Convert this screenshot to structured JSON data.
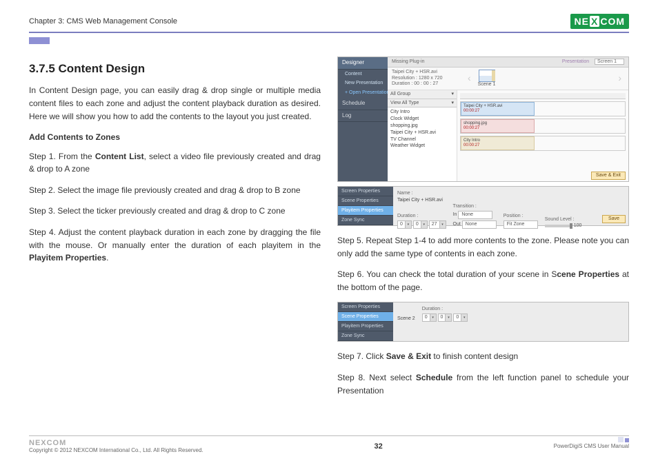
{
  "header": {
    "chapter": "Chapter 3: CMS Web Management Console",
    "brand_pre": "NE",
    "brand_mid": "X",
    "brand_post": "COM"
  },
  "left": {
    "heading": "3.7.5 Content Design",
    "intro": "In Content Design page, you can easily drag & drop single or multiple media content files to each zone and adjust the content playback duration as desired. Here we will show you how to add the contents to the layout you just created.",
    "sub": "Add Contents to Zones",
    "step1_a": "Step 1. From the ",
    "step1_b": "Content List",
    "step1_c": ", select a video file previously created and drag & drop to A zone",
    "step2": "Step 2. Select the image file previously created and drag & drop to B zone",
    "step3": "Step 3. Select the ticker previously created and drag & drop to C zone",
    "step4_a": "Step 4. Adjust the content playback duration in each zone by dragging the file with the mouse. Or manually enter the duration of each playitem in the ",
    "step4_b": "Playitem Properties",
    "step4_c": "."
  },
  "right": {
    "step5": "Step 5. Repeat Step 1-4 to add more contents to the zone. Please note you can only add the same type of contents in each zone.",
    "step6_a": "Step 6. You can check the total duration of your scene in S",
    "step6_b": "cene Properties",
    "step6_c": " at the bottom of the page.",
    "step7_a": "Step 7. Click ",
    "step7_b": "Save & Exit",
    "step7_c": " to finish content design",
    "step8_a": "Step 8. Next select ",
    "step8_b": "Schedule",
    "step8_c": " from the left function panel to schedule your Presentation"
  },
  "shot1": {
    "side": {
      "designer": "Designer",
      "content": "Content",
      "new_pres": "New Presentation",
      "open_pres": "+ Open Presentation",
      "schedule": "Schedule",
      "log": "Log"
    },
    "toolbar": {
      "missing": "Missing Plug-in",
      "presentation": "Presentation",
      "screen": "Screen 1"
    },
    "preview": {
      "file": "Taipei City + HSR.avi",
      "res": "Resolution : 1280 x 720",
      "dur": "Duration : 00 : 00 : 27",
      "scene": "Scene 1"
    },
    "list": {
      "group": "All Group",
      "type": "View All Type",
      "items": [
        "City Intro",
        "Clock Widget",
        "shopping.jpg",
        "Taipei City + HSR.avi",
        "TV Channel",
        "Weather Widget"
      ]
    },
    "tracks": {
      "t1_name": "Taipei City + HSR.avi",
      "t1_ts": "00:00:27",
      "t2_name": "shopping.jpg",
      "t2_ts": "00:00:27",
      "t3_name": "City Intro",
      "t3_ts": "00:00:27"
    },
    "save_exit": "Save & Exit"
  },
  "shot2": {
    "tabs": [
      "Screen Properties",
      "Scene Properties",
      "Playitem Properties",
      "Zone Sync"
    ],
    "name_label": "Name :",
    "name_value": "Taipei City + HSR.avi",
    "duration_label": "Duration :",
    "dur_h": "0",
    "dur_m": "0",
    "dur_s": "27",
    "transition_label": "Transition :",
    "trans_in_label": "In",
    "trans_out_label": "Out",
    "trans_none": "None",
    "position_label": "Position :",
    "position_value": "Fit Zone",
    "sound_label": "Sound Level :",
    "sound_value": "100",
    "save": "Save"
  },
  "shot3": {
    "tabs": [
      "Screen Properties",
      "Scene Properties",
      "Playitem Properties",
      "Zone Sync"
    ],
    "scene_label": "Scene 2",
    "duration_label": "Duration :",
    "dur_h": "0",
    "dur_m": "0",
    "dur_s": "0"
  },
  "footer": {
    "brand": "NEXCOM",
    "copyright": "Copyright © 2012 NEXCOM International Co., Ltd. All Rights Reserved.",
    "page": "32",
    "manual": "PowerDigiS CMS User Manual"
  }
}
